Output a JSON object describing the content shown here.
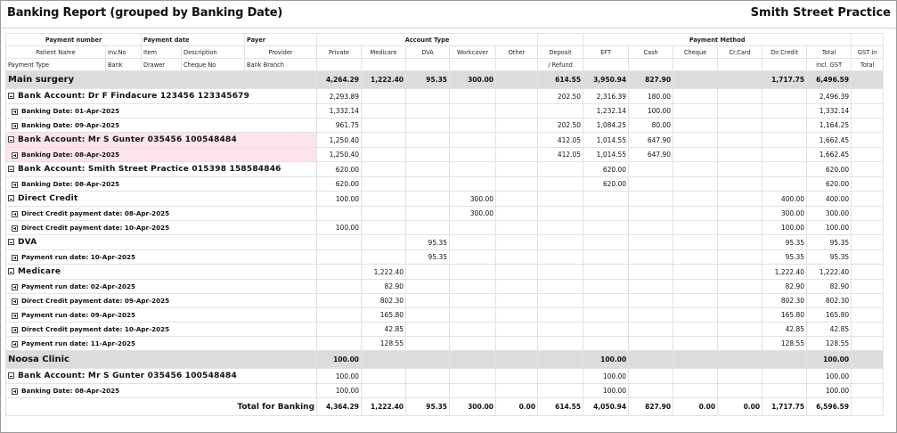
{
  "report": {
    "title": "Banking Report (grouped by Banking Date)",
    "practice": "Smith Street Practice"
  },
  "header": {
    "row1": {
      "payment_number": "Payment number",
      "payment_date": "Payment date",
      "payer": "Payer",
      "account_type": "Account Type",
      "payment_method": "Payment Method"
    },
    "row2": {
      "patient_name": "Patient Name",
      "inv_no": "Inv.No",
      "item": "Item",
      "description": "Description",
      "provider": "Provider",
      "private": "Private",
      "medicare": "Medicare",
      "dva": "DVA",
      "workcover": "Workcover",
      "other": "Other",
      "deposit": "Deposit",
      "eft": "EFT",
      "cash": "Cash",
      "cheque": "Cheque",
      "crcard": "Cr.Card",
      "dircredit": "Dir.Credit",
      "total": "Total",
      "gst_in": "GST in"
    },
    "row3": {
      "payment_type": "Payment Type",
      "bank": "Bank",
      "drawer": "Drawer",
      "cheque_no": "Cheque No",
      "bank_branch": "Bank Branch",
      "refund": "/ Refund",
      "incl_gst": "incl. GST",
      "total": "Total"
    }
  },
  "rows": [
    {
      "kind": "group",
      "label": "Main surgery",
      "private": "4,264.29",
      "medicare": "1,222.40",
      "dva": "95.35",
      "workcover": "300.00",
      "other": "",
      "deposit": "614.55",
      "eft": "3,950.94",
      "cash": "827.90",
      "cheque": "",
      "crcard": "",
      "dircredit": "1,717.75",
      "total": "6,496.59",
      "gst": ""
    },
    {
      "kind": "acct",
      "icon": "minus",
      "label": "Bank Account: Dr F Findacure  123456 123345679",
      "private": "2,293.89",
      "medicare": "",
      "dva": "",
      "workcover": "",
      "other": "",
      "deposit": "202.50",
      "eft": "2,316.39",
      "cash": "180.00",
      "cheque": "",
      "crcard": "",
      "dircredit": "",
      "total": "2,496.39",
      "gst": ""
    },
    {
      "kind": "sub",
      "icon": "plus",
      "label": "Banking Date: 01-Apr-2025",
      "private": "1,332.14",
      "medicare": "",
      "dva": "",
      "workcover": "",
      "other": "",
      "deposit": "",
      "eft": "1,232.14",
      "cash": "100.00",
      "cheque": "",
      "crcard": "",
      "dircredit": "",
      "total": "1,332.14",
      "gst": ""
    },
    {
      "kind": "sub",
      "icon": "plus",
      "label": "Banking Date: 09-Apr-2025",
      "private": "961.75",
      "medicare": "",
      "dva": "",
      "workcover": "",
      "other": "",
      "deposit": "202.50",
      "eft": "1,084.25",
      "cash": "80.00",
      "cheque": "",
      "crcard": "",
      "dircredit": "",
      "total": "1,164.25",
      "gst": ""
    },
    {
      "kind": "acct",
      "icon": "minus",
      "hl": true,
      "label": "Bank Account: Mr S Gunter  035456 100548484",
      "private": "1,250.40",
      "medicare": "",
      "dva": "",
      "workcover": "",
      "other": "",
      "deposit": "412.05",
      "eft": "1,014.55",
      "cash": "647.90",
      "cheque": "",
      "crcard": "",
      "dircredit": "",
      "total": "1,662.45",
      "gst": ""
    },
    {
      "kind": "sub",
      "icon": "plus",
      "hl": true,
      "label": "Banking Date: 08-Apr-2025",
      "private": "1,250.40",
      "medicare": "",
      "dva": "",
      "workcover": "",
      "other": "",
      "deposit": "412.05",
      "eft": "1,014.55",
      "cash": "647.90",
      "cheque": "",
      "crcard": "",
      "dircredit": "",
      "total": "1,662.45",
      "gst": ""
    },
    {
      "kind": "acct",
      "icon": "minus",
      "label": "Bank Account: Smith Street Practice  015398 158584846",
      "private": "620.00",
      "medicare": "",
      "dva": "",
      "workcover": "",
      "other": "",
      "deposit": "",
      "eft": "620.00",
      "cash": "",
      "cheque": "",
      "crcard": "",
      "dircredit": "",
      "total": "620.00",
      "gst": ""
    },
    {
      "kind": "sub",
      "icon": "plus",
      "label": "Banking Date: 08-Apr-2025",
      "private": "620.00",
      "medicare": "",
      "dva": "",
      "workcover": "",
      "other": "",
      "deposit": "",
      "eft": "620.00",
      "cash": "",
      "cheque": "",
      "crcard": "",
      "dircredit": "",
      "total": "620.00",
      "gst": ""
    },
    {
      "kind": "acct",
      "icon": "minus",
      "label": "Direct Credit",
      "private": "100.00",
      "medicare": "",
      "dva": "",
      "workcover": "300.00",
      "other": "",
      "deposit": "",
      "eft": "",
      "cash": "",
      "cheque": "",
      "crcard": "",
      "dircredit": "400.00",
      "total": "400.00",
      "gst": ""
    },
    {
      "kind": "sub",
      "icon": "plus",
      "label": "Direct Credit payment date: 08-Apr-2025",
      "private": "",
      "medicare": "",
      "dva": "",
      "workcover": "300.00",
      "other": "",
      "deposit": "",
      "eft": "",
      "cash": "",
      "cheque": "",
      "crcard": "",
      "dircredit": "300.00",
      "total": "300.00",
      "gst": ""
    },
    {
      "kind": "sub",
      "icon": "plus",
      "label": "Direct Credit payment date: 10-Apr-2025",
      "private": "100.00",
      "medicare": "",
      "dva": "",
      "workcover": "",
      "other": "",
      "deposit": "",
      "eft": "",
      "cash": "",
      "cheque": "",
      "crcard": "",
      "dircredit": "100.00",
      "total": "100.00",
      "gst": ""
    },
    {
      "kind": "acct",
      "icon": "minus",
      "label": "DVA",
      "private": "",
      "medicare": "",
      "dva": "95.35",
      "workcover": "",
      "other": "",
      "deposit": "",
      "eft": "",
      "cash": "",
      "cheque": "",
      "crcard": "",
      "dircredit": "95.35",
      "total": "95.35",
      "gst": ""
    },
    {
      "kind": "sub",
      "icon": "plus",
      "label": "Payment run date: 10-Apr-2025",
      "private": "",
      "medicare": "",
      "dva": "95.35",
      "workcover": "",
      "other": "",
      "deposit": "",
      "eft": "",
      "cash": "",
      "cheque": "",
      "crcard": "",
      "dircredit": "95.35",
      "total": "95.35",
      "gst": ""
    },
    {
      "kind": "acct",
      "icon": "minus",
      "label": "Medicare",
      "private": "",
      "medicare": "1,222.40",
      "dva": "",
      "workcover": "",
      "other": "",
      "deposit": "",
      "eft": "",
      "cash": "",
      "cheque": "",
      "crcard": "",
      "dircredit": "1,222.40",
      "total": "1,222.40",
      "gst": ""
    },
    {
      "kind": "sub",
      "icon": "plus",
      "label": "Payment run date: 02-Apr-2025",
      "private": "",
      "medicare": "82.90",
      "dva": "",
      "workcover": "",
      "other": "",
      "deposit": "",
      "eft": "",
      "cash": "",
      "cheque": "",
      "crcard": "",
      "dircredit": "82.90",
      "total": "82.90",
      "gst": ""
    },
    {
      "kind": "sub",
      "icon": "plus",
      "label": "Direct Credit payment date: 09-Apr-2025",
      "private": "",
      "medicare": "802.30",
      "dva": "",
      "workcover": "",
      "other": "",
      "deposit": "",
      "eft": "",
      "cash": "",
      "cheque": "",
      "crcard": "",
      "dircredit": "802.30",
      "total": "802.30",
      "gst": ""
    },
    {
      "kind": "sub",
      "icon": "plus",
      "label": "Payment run date: 09-Apr-2025",
      "private": "",
      "medicare": "165.80",
      "dva": "",
      "workcover": "",
      "other": "",
      "deposit": "",
      "eft": "",
      "cash": "",
      "cheque": "",
      "crcard": "",
      "dircredit": "165.80",
      "total": "165.80",
      "gst": ""
    },
    {
      "kind": "sub",
      "icon": "plus",
      "label": "Direct Credit payment date: 10-Apr-2025",
      "private": "",
      "medicare": "42.85",
      "dva": "",
      "workcover": "",
      "other": "",
      "deposit": "",
      "eft": "",
      "cash": "",
      "cheque": "",
      "crcard": "",
      "dircredit": "42.85",
      "total": "42.85",
      "gst": ""
    },
    {
      "kind": "sub",
      "icon": "plus",
      "label": "Payment run date: 11-Apr-2025",
      "private": "",
      "medicare": "128.55",
      "dva": "",
      "workcover": "",
      "other": "",
      "deposit": "",
      "eft": "",
      "cash": "",
      "cheque": "",
      "crcard": "",
      "dircredit": "128.55",
      "total": "128.55",
      "gst": ""
    },
    {
      "kind": "group",
      "label": "Noosa Clinic",
      "private": "100.00",
      "medicare": "",
      "dva": "",
      "workcover": "",
      "other": "",
      "deposit": "",
      "eft": "100.00",
      "cash": "",
      "cheque": "",
      "crcard": "",
      "dircredit": "",
      "total": "100.00",
      "gst": ""
    },
    {
      "kind": "acct",
      "icon": "minus",
      "label": "Bank Account: Mr S Gunter  035456 100548484",
      "private": "100.00",
      "medicare": "",
      "dva": "",
      "workcover": "",
      "other": "",
      "deposit": "",
      "eft": "100.00",
      "cash": "",
      "cheque": "",
      "crcard": "",
      "dircredit": "",
      "total": "100.00",
      "gst": ""
    },
    {
      "kind": "sub",
      "icon": "plus",
      "label": "Banking Date: 08-Apr-2025",
      "private": "100.00",
      "medicare": "",
      "dva": "",
      "workcover": "",
      "other": "",
      "deposit": "",
      "eft": "100.00",
      "cash": "",
      "cheque": "",
      "crcard": "",
      "dircredit": "",
      "total": "100.00",
      "gst": ""
    }
  ],
  "totals": {
    "label": "Total for Banking",
    "private": "4,364.29",
    "medicare": "1,222.40",
    "dva": "95.35",
    "workcover": "300.00",
    "other": "0.00",
    "deposit": "614.55",
    "eft": "4,050.94",
    "cash": "827.90",
    "cheque": "0.00",
    "crcard": "0.00",
    "dircredit": "1,717.75",
    "total": "6,596.59",
    "gst": ""
  }
}
